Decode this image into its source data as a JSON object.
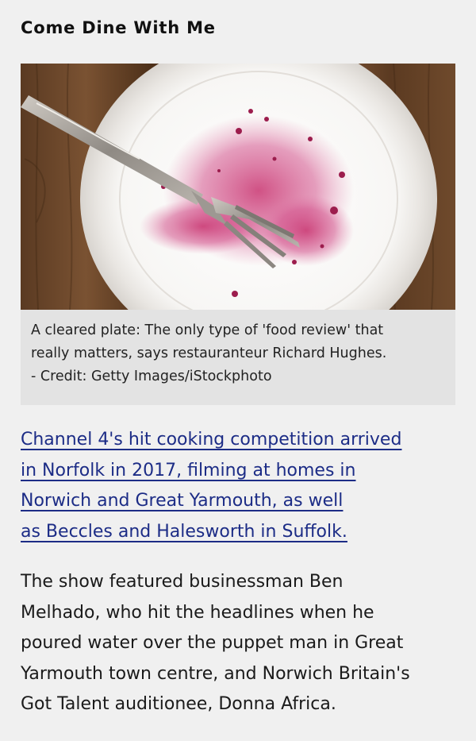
{
  "article": {
    "headline": "Come Dine With Me",
    "figure": {
      "image_description_icon": "cleared-plate-photo",
      "caption_lines": [
        "A cleared plate: The only type of 'food review' that",
        "really matters, says restauranteur Richard Hughes.",
        "- Credit: Getty Images/iStockphoto"
      ]
    },
    "link_paragraph_lines": [
      "Channel 4's hit cooking competition arrived",
      "in Norfolk in 2017, filming at homes in",
      "Norwich and Great Yarmouth, as well",
      "as Beccles and Halesworth in Suffolk."
    ],
    "body_paragraph_lines": [
      "The show featured businessman Ben",
      "Melhado, who hit the headlines when he",
      "poured water over the puppet man in Great",
      "Yarmouth town centre, and Norwich Britain's",
      "Got Talent auditionee, Donna Africa."
    ]
  },
  "colors": {
    "background": "#f0f0f0",
    "caption_background": "#e3e3e3",
    "link": "#1c2c86",
    "text": "#1a1a1a"
  }
}
